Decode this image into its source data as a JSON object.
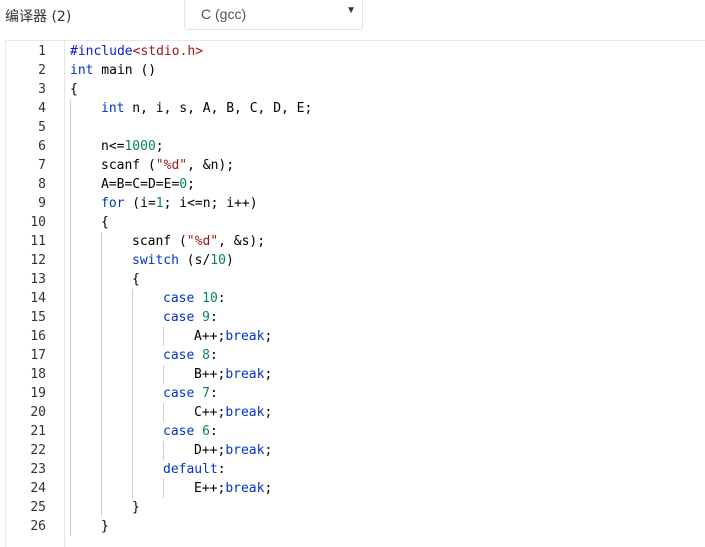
{
  "toolbar": {
    "compiler_label": "编译器 (2)",
    "language_select": {
      "value": "C (gcc)",
      "arrow": "▼"
    }
  },
  "editor": {
    "lines": [
      {
        "n": "1",
        "indent": 0,
        "tokens": [
          [
            "inc",
            "#include"
          ],
          [
            "incf",
            "<stdio.h>"
          ]
        ]
      },
      {
        "n": "2",
        "indent": 0,
        "tokens": [
          [
            "kw",
            "int"
          ],
          [
            "pl",
            " main ()"
          ]
        ]
      },
      {
        "n": "3",
        "indent": 0,
        "tokens": [
          [
            "pl",
            "{"
          ]
        ]
      },
      {
        "n": "4",
        "indent": 1,
        "tokens": [
          [
            "kw",
            "int"
          ],
          [
            "pl",
            " n, i, s, A, B, C, D, E;"
          ]
        ]
      },
      {
        "n": "5",
        "indent": 1,
        "tokens": []
      },
      {
        "n": "6",
        "indent": 1,
        "tokens": [
          [
            "pl",
            "n<="
          ],
          [
            "num",
            "1000"
          ],
          [
            "pl",
            ";"
          ]
        ]
      },
      {
        "n": "7",
        "indent": 1,
        "tokens": [
          [
            "pl",
            "scanf ("
          ],
          [
            "str",
            "\"%d\""
          ],
          [
            "pl",
            ", &n);"
          ]
        ]
      },
      {
        "n": "8",
        "indent": 1,
        "tokens": [
          [
            "pl",
            "A=B=C=D=E="
          ],
          [
            "num",
            "0"
          ],
          [
            "pl",
            ";"
          ]
        ]
      },
      {
        "n": "9",
        "indent": 1,
        "tokens": [
          [
            "kw",
            "for"
          ],
          [
            "pl",
            " (i="
          ],
          [
            "num",
            "1"
          ],
          [
            "pl",
            "; i<=n; i++)"
          ]
        ]
      },
      {
        "n": "10",
        "indent": 1,
        "tokens": [
          [
            "pl",
            "{"
          ]
        ]
      },
      {
        "n": "11",
        "indent": 2,
        "tokens": [
          [
            "pl",
            "scanf ("
          ],
          [
            "str",
            "\"%d\""
          ],
          [
            "pl",
            ", &s);"
          ]
        ]
      },
      {
        "n": "12",
        "indent": 2,
        "tokens": [
          [
            "kw",
            "switch"
          ],
          [
            "pl",
            " (s/"
          ],
          [
            "num",
            "10"
          ],
          [
            "pl",
            ")"
          ]
        ]
      },
      {
        "n": "13",
        "indent": 2,
        "tokens": [
          [
            "pl",
            "{"
          ]
        ]
      },
      {
        "n": "14",
        "indent": 3,
        "tokens": [
          [
            "kw",
            "case"
          ],
          [
            "pl",
            " "
          ],
          [
            "num",
            "10"
          ],
          [
            "pl",
            ":"
          ]
        ]
      },
      {
        "n": "15",
        "indent": 3,
        "tokens": [
          [
            "kw",
            "case"
          ],
          [
            "pl",
            " "
          ],
          [
            "num",
            "9"
          ],
          [
            "pl",
            ":"
          ]
        ]
      },
      {
        "n": "16",
        "indent": 4,
        "tokens": [
          [
            "pl",
            "A++;"
          ],
          [
            "kw",
            "break"
          ],
          [
            "pl",
            ";"
          ]
        ]
      },
      {
        "n": "17",
        "indent": 3,
        "tokens": [
          [
            "kw",
            "case"
          ],
          [
            "pl",
            " "
          ],
          [
            "num",
            "8"
          ],
          [
            "pl",
            ":"
          ]
        ]
      },
      {
        "n": "18",
        "indent": 4,
        "tokens": [
          [
            "pl",
            "B++;"
          ],
          [
            "kw",
            "break"
          ],
          [
            "pl",
            ";"
          ]
        ]
      },
      {
        "n": "19",
        "indent": 3,
        "tokens": [
          [
            "kw",
            "case"
          ],
          [
            "pl",
            " "
          ],
          [
            "num",
            "7"
          ],
          [
            "pl",
            ":"
          ]
        ]
      },
      {
        "n": "20",
        "indent": 4,
        "tokens": [
          [
            "pl",
            "C++;"
          ],
          [
            "kw",
            "break"
          ],
          [
            "pl",
            ";"
          ]
        ]
      },
      {
        "n": "21",
        "indent": 3,
        "tokens": [
          [
            "kw",
            "case"
          ],
          [
            "pl",
            " "
          ],
          [
            "num",
            "6"
          ],
          [
            "pl",
            ":"
          ]
        ]
      },
      {
        "n": "22",
        "indent": 4,
        "tokens": [
          [
            "pl",
            "D++;"
          ],
          [
            "kw",
            "break"
          ],
          [
            "pl",
            ";"
          ]
        ]
      },
      {
        "n": "23",
        "indent": 3,
        "tokens": [
          [
            "kw",
            "default"
          ],
          [
            "pl",
            ":"
          ]
        ]
      },
      {
        "n": "24",
        "indent": 4,
        "tokens": [
          [
            "pl",
            "E++;"
          ],
          [
            "kw",
            "break"
          ],
          [
            "pl",
            ";"
          ]
        ]
      },
      {
        "n": "25",
        "indent": 2,
        "tokens": [
          [
            "pl",
            "}"
          ]
        ]
      },
      {
        "n": "26",
        "indent": 1,
        "tokens": [
          [
            "pl",
            "}"
          ]
        ]
      }
    ]
  },
  "colors": {
    "keyword": "#0033cc",
    "number": "#098658",
    "string": "#a31515",
    "include": "#0b1ec8"
  }
}
